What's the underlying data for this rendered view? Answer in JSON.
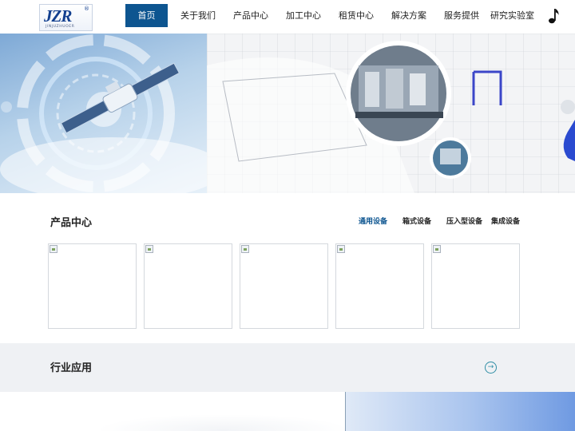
{
  "header": {
    "logo": {
      "text": "JZR",
      "sub": "JINJUZHUOER",
      "reg": "®"
    },
    "nav": [
      {
        "label": "首页",
        "active": true
      },
      {
        "label": "关于我们",
        "active": false
      },
      {
        "label": "产品中心",
        "active": false
      },
      {
        "label": "加工中心",
        "active": false
      },
      {
        "label": "租赁中心",
        "active": false
      },
      {
        "label": "解决方案",
        "active": false
      },
      {
        "label": "服务提供",
        "active": false
      },
      {
        "label": "研究实验室",
        "active": false
      }
    ],
    "music_icon": "music-note-icon"
  },
  "products": {
    "title": "产品中心",
    "tabs": [
      {
        "label": "通用设备",
        "active": true
      },
      {
        "label": "箱式设备",
        "active": false
      },
      {
        "label": "压入型设备",
        "active": false
      },
      {
        "label": "集成设备",
        "active": false
      }
    ],
    "cards": [
      "",
      "",
      "",
      "",
      ""
    ]
  },
  "industry": {
    "title": "行业应用",
    "arrow_icon": "arrow-right-circle-icon"
  },
  "colors": {
    "accent": "#0d5590",
    "industry_bg": "#eff1f4",
    "arrow": "#2f8ea5"
  }
}
